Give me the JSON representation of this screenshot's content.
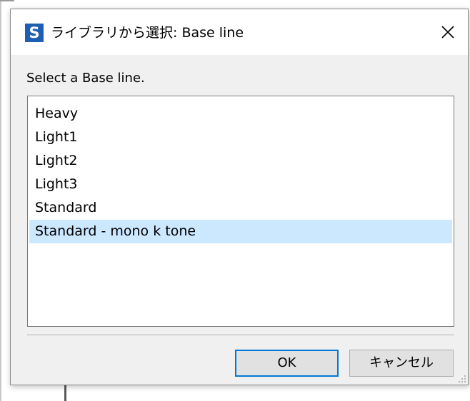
{
  "dialog": {
    "app_icon_letter": "S",
    "title": "ライブラリから選択: Base line",
    "prompt": "Select a Base line.",
    "ok_label": "OK",
    "cancel_label": "キャンセル"
  },
  "list": {
    "items": [
      {
        "label": "Heavy",
        "selected": false
      },
      {
        "label": "Light1",
        "selected": false
      },
      {
        "label": "Light2",
        "selected": false
      },
      {
        "label": "Light3",
        "selected": false
      },
      {
        "label": "Standard",
        "selected": false
      },
      {
        "label": "Standard - mono k tone",
        "selected": true
      }
    ]
  },
  "colors": {
    "selection": "#cce8ff",
    "app_icon": "#1e5fb4",
    "default_button_border": "#0078d7"
  },
  "icons": {
    "close": "close-icon",
    "app": "app-s-icon",
    "grip": "resize-grip-icon"
  }
}
